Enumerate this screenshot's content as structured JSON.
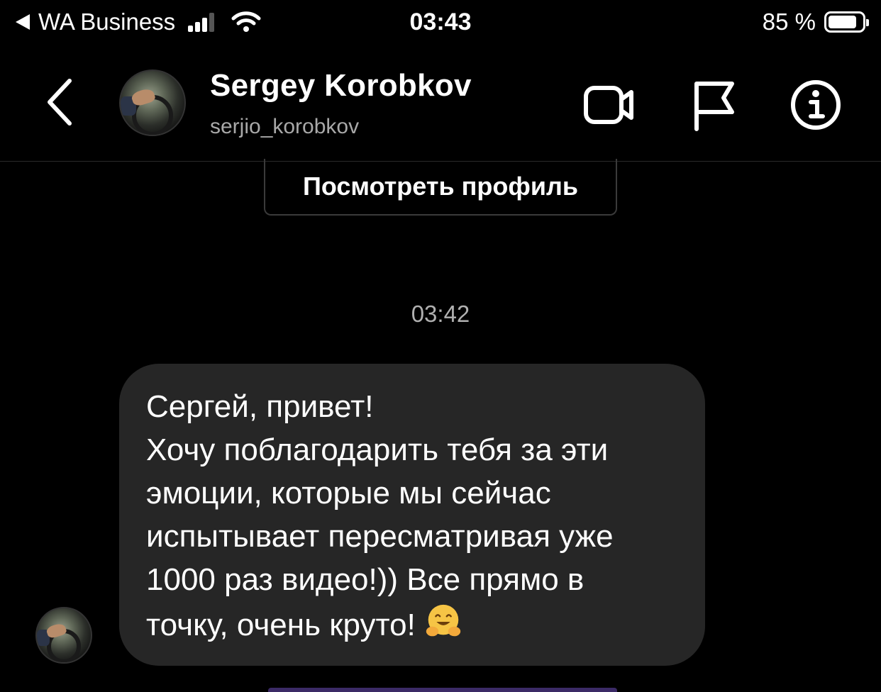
{
  "status_bar": {
    "back_app": "WA Business",
    "time": "03:43",
    "battery": "85 %"
  },
  "header": {
    "name": "Sergey Korobkov",
    "username": "serjio_korobkov",
    "icons": [
      "chevron-left-icon",
      "video-camera-icon",
      "flag-icon",
      "info-icon"
    ]
  },
  "profile_button": {
    "label": "Посмотреть профиль"
  },
  "chat": {
    "timestamp": "03:42",
    "message": {
      "text": "Сергей, привет!\nХочу поблагодарить тебя за эти\nэмоции, которые мы сейчас\nиспытывает пересматривая уже\n1000 раз видео!)) Все прямо в\nточку, очень круто!",
      "emoji": "hugging-face-emoji"
    }
  },
  "colors": {
    "background": "#000000",
    "bubble": "#262626",
    "secondary_text": "#a8a8a8"
  }
}
